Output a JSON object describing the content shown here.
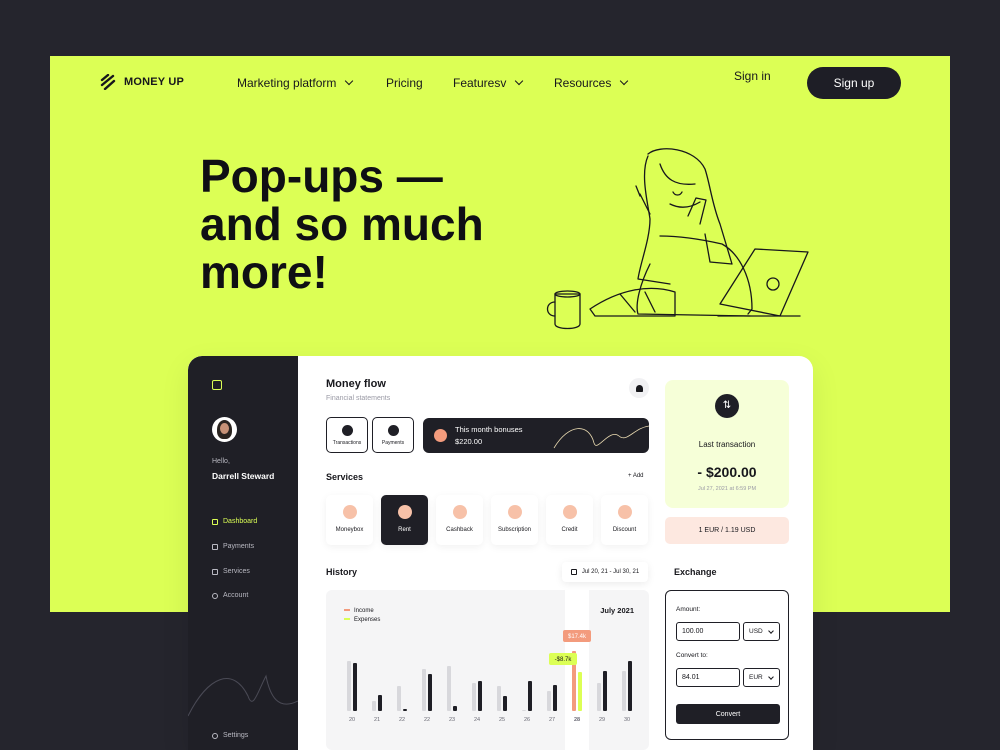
{
  "brand": {
    "name": "MONEY UP"
  },
  "nav": {
    "items": [
      {
        "label": "Marketing platform",
        "has_dropdown": true
      },
      {
        "label": "Pricing",
        "has_dropdown": false
      },
      {
        "label": "Featuresv",
        "has_dropdown": true
      },
      {
        "label": "Resources",
        "has_dropdown": true
      }
    ],
    "signin": "Sign in",
    "signup": "Sign up"
  },
  "hero": {
    "line1": "Pop-ups —",
    "line2": "and so much",
    "line3": "more!"
  },
  "sidebar": {
    "greeting": "Hello,",
    "user_name": "Darrell Steward",
    "items": [
      {
        "label": "Dashboard",
        "active": true
      },
      {
        "label": "Payments",
        "active": false
      },
      {
        "label": "Services",
        "active": false
      },
      {
        "label": "Account",
        "active": false
      }
    ],
    "settings": "Settings"
  },
  "main": {
    "title": "Money flow",
    "subtitle": "Financial statements",
    "quick": [
      {
        "label": "Transactions"
      },
      {
        "label": "Payments"
      }
    ],
    "bonus": {
      "title": "This month bonuses",
      "value": "$220.00"
    },
    "services_title": "Services",
    "services_add": "+ Add",
    "services": [
      {
        "label": "Moneybox"
      },
      {
        "label": "Rent"
      },
      {
        "label": "Cashback"
      },
      {
        "label": "Subscription"
      },
      {
        "label": "Credit"
      },
      {
        "label": "Discount"
      }
    ],
    "history_title": "History",
    "date_range": "Jul 20, 21 - Jul 30, 21"
  },
  "chart_data": {
    "type": "bar",
    "title": "July 2021",
    "categories": [
      "20",
      "21",
      "22",
      "22",
      "23",
      "24",
      "25",
      "26",
      "27",
      "28",
      "29",
      "30"
    ],
    "highlight_category_index": 9,
    "series": [
      {
        "name": "Income",
        "color": "#f39b7d",
        "values": [
          50,
          10,
          25,
          42,
          45,
          28,
          25,
          0,
          20,
          60,
          28,
          40
        ]
      },
      {
        "name": "Expenses",
        "color": "#dcff55",
        "values": [
          48,
          16,
          2,
          37,
          5,
          30,
          15,
          30,
          26,
          39,
          40,
          50
        ]
      }
    ],
    "annotations": [
      "-$8.7k",
      "$17.4k"
    ]
  },
  "right": {
    "last_label": "Last transaction",
    "last_amount": "- $200.00",
    "last_date": "Jul 27, 2021 at 6:59 PM",
    "rate": "1 EUR / 1.19 USD",
    "exchange_title": "Exchange",
    "amount_label": "Amount:",
    "amount_value": "100.00",
    "amount_currency": "USD",
    "convert_label": "Convert to:",
    "convert_value": "84.01",
    "convert_currency": "EUR",
    "convert_button": "Convert"
  }
}
